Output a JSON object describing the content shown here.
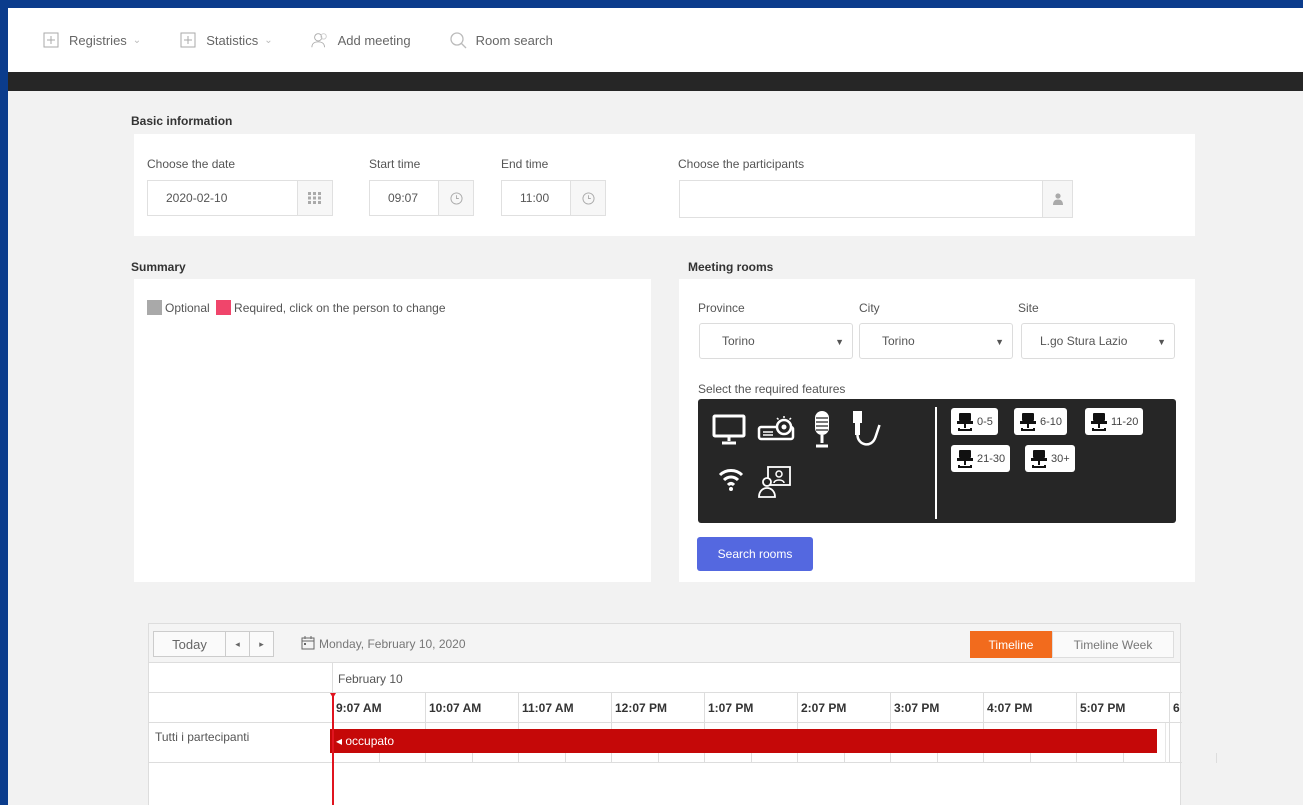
{
  "nav": {
    "registries": "Registries",
    "statistics": "Statistics",
    "add_meeting": "Add meeting",
    "room_search": "Room search"
  },
  "basic": {
    "title": "Basic information",
    "date_label": "Choose the date",
    "date_value": "2020-02-10",
    "start_label": "Start time",
    "start_value": "09:07",
    "end_label": "End time",
    "end_value": "11:00",
    "participants_label": "Choose the participants",
    "participants_value": ""
  },
  "summary": {
    "title": "Summary",
    "optional": "Optional",
    "required": "Required, click on the person to change",
    "optional_color": "#a9a9a9",
    "required_color": "#f0456b"
  },
  "rooms": {
    "title": "Meeting rooms",
    "province_label": "Province",
    "province_value": "Torino",
    "city_label": "City",
    "city_value": "Torino",
    "site_label": "Site",
    "site_value": "L.go Stura Lazio",
    "features_label": "Select the required features",
    "features": [
      "monitor-icon",
      "projector-icon",
      "microphone-icon",
      "network-cable-icon",
      "wifi-icon",
      "videoconference-icon"
    ],
    "capacities": [
      "0-5",
      "6-10",
      "11-20",
      "21-30",
      "30+"
    ],
    "search_button": "Search rooms"
  },
  "schedule": {
    "today": "Today",
    "prev": "◂",
    "next": "▸",
    "date_title": "Monday, February 10, 2020",
    "view_timeline": "Timeline",
    "view_timeline_week": "Timeline Week",
    "day_header": "February 10",
    "hours": [
      "9:07 AM",
      "10:07 AM",
      "11:07 AM",
      "12:07 PM",
      "1:07 PM",
      "2:07 PM",
      "3:07 PM",
      "4:07 PM",
      "5:07 PM",
      "6"
    ],
    "resource": "Tutti i partecipanti",
    "event_label": "◂ occupato",
    "event_color": "#c50808",
    "accent_color": "#f26b1d"
  }
}
